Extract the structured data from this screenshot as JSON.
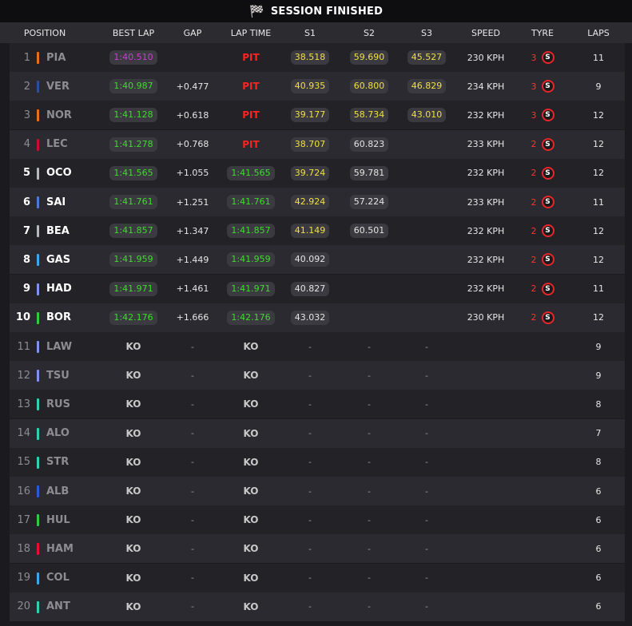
{
  "title": "SESSION FINISHED",
  "flag_icon": "checkered-flag-icon",
  "columns": [
    "POSITION",
    "BEST LAP",
    "GAP",
    "LAP TIME",
    "S1",
    "S2",
    "S3",
    "SPEED",
    "TYRE",
    "LAPS"
  ],
  "colors": {
    "green_time": "#3ddc2a",
    "purple_time": "#d03ad6",
    "yellow_sector": "#f0e03a",
    "pit": "#ff2222",
    "tyre_red": "#e8252a"
  },
  "rows": [
    {
      "pos": "1",
      "driver": "PIA",
      "team_color": "#e8701a",
      "best": "1:40.510",
      "best_color": "purple",
      "gap": "",
      "lap": "PIT",
      "lap_type": "pit",
      "s1": "38.518",
      "s1c": "yellow",
      "s2": "59.690",
      "s2c": "yellow",
      "s3": "45.527",
      "s3c": "yellow",
      "speed": "230 KPH",
      "tyre": "3",
      "laps": "11",
      "finished": false
    },
    {
      "pos": "2",
      "driver": "VER",
      "team_color": "#2b4e9e",
      "best": "1:40.987",
      "best_color": "green",
      "gap": "+0.477",
      "lap": "PIT",
      "lap_type": "pit",
      "s1": "40.935",
      "s1c": "yellow",
      "s2": "60.800",
      "s2c": "yellow",
      "s3": "46.829",
      "s3c": "yellow",
      "speed": "234 KPH",
      "tyre": "3",
      "laps": "9",
      "finished": false
    },
    {
      "pos": "3",
      "driver": "NOR",
      "team_color": "#e8701a",
      "best": "1:41.128",
      "best_color": "green",
      "gap": "+0.618",
      "lap": "PIT",
      "lap_type": "pit",
      "s1": "39.177",
      "s1c": "yellow",
      "s2": "58.734",
      "s2c": "yellow",
      "s3": "43.010",
      "s3c": "yellow",
      "speed": "232 KPH",
      "tyre": "3",
      "laps": "12",
      "finished": false
    },
    {
      "pos": "4",
      "driver": "LEC",
      "team_color": "#c8102e",
      "best": "1:41.278",
      "best_color": "green",
      "gap": "+0.768",
      "lap": "PIT",
      "lap_type": "pit",
      "s1": "38.707",
      "s1c": "yellow",
      "s2": "60.823",
      "s2c": "white",
      "s3": "",
      "s3c": "",
      "speed": "233 KPH",
      "tyre": "2",
      "laps": "12",
      "finished": false
    },
    {
      "pos": "5",
      "driver": "OCO",
      "team_color": "#b6babd",
      "best": "1:41.565",
      "best_color": "green",
      "gap": "+1.055",
      "lap": "1:41.565",
      "lap_type": "green",
      "s1": "39.724",
      "s1c": "yellow",
      "s2": "59.781",
      "s2c": "white",
      "s3": "",
      "s3c": "",
      "speed": "232 KPH",
      "tyre": "2",
      "laps": "12",
      "finished": true
    },
    {
      "pos": "6",
      "driver": "SAI",
      "team_color": "#4a7bd8",
      "best": "1:41.761",
      "best_color": "green",
      "gap": "+1.251",
      "lap": "1:41.761",
      "lap_type": "green",
      "s1": "42.924",
      "s1c": "yellow",
      "s2": "57.224",
      "s2c": "white",
      "s3": "",
      "s3c": "",
      "speed": "233 KPH",
      "tyre": "2",
      "laps": "11",
      "finished": true
    },
    {
      "pos": "7",
      "driver": "BEA",
      "team_color": "#b6babd",
      "best": "1:41.857",
      "best_color": "green",
      "gap": "+1.347",
      "lap": "1:41.857",
      "lap_type": "green",
      "s1": "41.149",
      "s1c": "yellow",
      "s2": "60.501",
      "s2c": "white",
      "s3": "",
      "s3c": "",
      "speed": "232 KPH",
      "tyre": "2",
      "laps": "12",
      "finished": true
    },
    {
      "pos": "8",
      "driver": "GAS",
      "team_color": "#3aa7ef",
      "best": "1:41.959",
      "best_color": "green",
      "gap": "+1.449",
      "lap": "1:41.959",
      "lap_type": "green",
      "s1": "40.092",
      "s1c": "white",
      "s2": "",
      "s2c": "",
      "s3": "",
      "s3c": "",
      "speed": "232 KPH",
      "tyre": "2",
      "laps": "12",
      "finished": true
    },
    {
      "pos": "9",
      "driver": "HAD",
      "team_color": "#7d93f0",
      "best": "1:41.971",
      "best_color": "green",
      "gap": "+1.461",
      "lap": "1:41.971",
      "lap_type": "green",
      "s1": "40.827",
      "s1c": "white",
      "s2": "",
      "s2c": "",
      "s3": "",
      "s3c": "",
      "speed": "232 KPH",
      "tyre": "2",
      "laps": "11",
      "finished": true
    },
    {
      "pos": "10",
      "driver": "BOR",
      "team_color": "#2ecc40",
      "best": "1:42.176",
      "best_color": "green",
      "gap": "+1.666",
      "lap": "1:42.176",
      "lap_type": "green",
      "s1": "43.032",
      "s1c": "white",
      "s2": "",
      "s2c": "",
      "s3": "",
      "s3c": "",
      "speed": "230 KPH",
      "tyre": "2",
      "laps": "12",
      "finished": true
    },
    {
      "pos": "11",
      "driver": "LAW",
      "team_color": "#7d93f0",
      "best": "KO",
      "best_color": "ko",
      "gap": "-",
      "lap": "KO",
      "lap_type": "ko",
      "s1": "-",
      "s1c": "dash",
      "s2": "-",
      "s2c": "dash",
      "s3": "-",
      "s3c": "dash",
      "speed": "",
      "tyre": "",
      "laps": "9",
      "finished": false
    },
    {
      "pos": "12",
      "driver": "TSU",
      "team_color": "#7d93f0",
      "best": "KO",
      "best_color": "ko",
      "gap": "-",
      "lap": "KO",
      "lap_type": "ko",
      "s1": "-",
      "s1c": "dash",
      "s2": "-",
      "s2c": "dash",
      "s3": "-",
      "s3c": "dash",
      "speed": "",
      "tyre": "",
      "laps": "9",
      "finished": false
    },
    {
      "pos": "13",
      "driver": "RUS",
      "team_color": "#2fd1b5",
      "best": "KO",
      "best_color": "ko",
      "gap": "-",
      "lap": "KO",
      "lap_type": "ko",
      "s1": "-",
      "s1c": "dash",
      "s2": "-",
      "s2c": "dash",
      "s3": "-",
      "s3c": "dash",
      "speed": "",
      "tyre": "",
      "laps": "8",
      "finished": false
    },
    {
      "pos": "14",
      "driver": "ALO",
      "team_color": "#2fd1b5",
      "best": "KO",
      "best_color": "ko",
      "gap": "-",
      "lap": "KO",
      "lap_type": "ko",
      "s1": "-",
      "s1c": "dash",
      "s2": "-",
      "s2c": "dash",
      "s3": "-",
      "s3c": "dash",
      "speed": "",
      "tyre": "",
      "laps": "7",
      "finished": false
    },
    {
      "pos": "15",
      "driver": "STR",
      "team_color": "#2fd1b5",
      "best": "KO",
      "best_color": "ko",
      "gap": "-",
      "lap": "KO",
      "lap_type": "ko",
      "s1": "-",
      "s1c": "dash",
      "s2": "-",
      "s2c": "dash",
      "s3": "-",
      "s3c": "dash",
      "speed": "",
      "tyre": "",
      "laps": "8",
      "finished": false
    },
    {
      "pos": "16",
      "driver": "ALB",
      "team_color": "#2b5bd8",
      "best": "KO",
      "best_color": "ko",
      "gap": "-",
      "lap": "KO",
      "lap_type": "ko",
      "s1": "-",
      "s1c": "dash",
      "s2": "-",
      "s2c": "dash",
      "s3": "-",
      "s3c": "dash",
      "speed": "",
      "tyre": "",
      "laps": "6",
      "finished": false
    },
    {
      "pos": "17",
      "driver": "HUL",
      "team_color": "#2ecc40",
      "best": "KO",
      "best_color": "ko",
      "gap": "-",
      "lap": "KO",
      "lap_type": "ko",
      "s1": "-",
      "s1c": "dash",
      "s2": "-",
      "s2c": "dash",
      "s3": "-",
      "s3c": "dash",
      "speed": "",
      "tyre": "",
      "laps": "6",
      "finished": false
    },
    {
      "pos": "18",
      "driver": "HAM",
      "team_color": "#e8102e",
      "best": "KO",
      "best_color": "ko",
      "gap": "-",
      "lap": "KO",
      "lap_type": "ko",
      "s1": "-",
      "s1c": "dash",
      "s2": "-",
      "s2c": "dash",
      "s3": "-",
      "s3c": "dash",
      "speed": "",
      "tyre": "",
      "laps": "6",
      "finished": false
    },
    {
      "pos": "19",
      "driver": "COL",
      "team_color": "#3aa7ef",
      "best": "KO",
      "best_color": "ko",
      "gap": "-",
      "lap": "KO",
      "lap_type": "ko",
      "s1": "-",
      "s1c": "dash",
      "s2": "-",
      "s2c": "dash",
      "s3": "-",
      "s3c": "dash",
      "speed": "",
      "tyre": "",
      "laps": "6",
      "finished": false
    },
    {
      "pos": "20",
      "driver": "ANT",
      "team_color": "#2fd1b5",
      "best": "KO",
      "best_color": "ko",
      "gap": "-",
      "lap": "KO",
      "lap_type": "ko",
      "s1": "-",
      "s1c": "dash",
      "s2": "-",
      "s2c": "dash",
      "s3": "-",
      "s3c": "dash",
      "speed": "",
      "tyre": "",
      "laps": "6",
      "finished": false
    }
  ]
}
